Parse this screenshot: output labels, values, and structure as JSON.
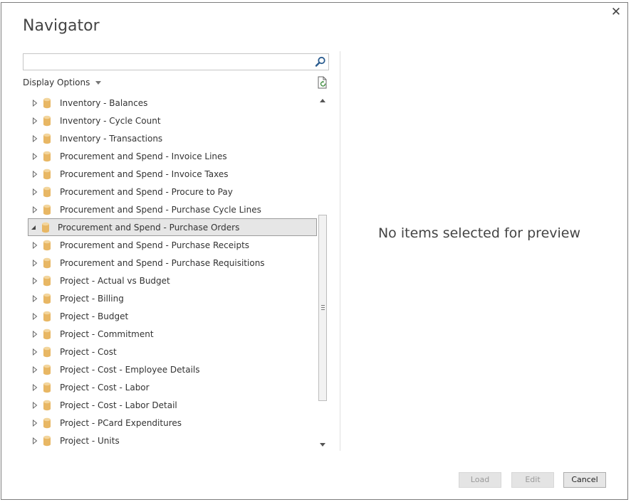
{
  "dialog": {
    "title": "Navigator",
    "close_icon": "close-icon"
  },
  "search": {
    "value": "",
    "placeholder": "",
    "icon": "search-icon"
  },
  "display_options": {
    "label": "Display Options",
    "icon": "chevron-down-icon"
  },
  "refresh": {
    "icon": "refresh-icon"
  },
  "tree": {
    "items": [
      {
        "label": "Inventory - Balances",
        "icon": "database-icon",
        "expanded": false,
        "selected": false
      },
      {
        "label": "Inventory - Cycle Count",
        "icon": "database-icon",
        "expanded": false,
        "selected": false
      },
      {
        "label": "Inventory - Transactions",
        "icon": "database-icon",
        "expanded": false,
        "selected": false
      },
      {
        "label": "Procurement and Spend - Invoice Lines",
        "icon": "database-icon",
        "expanded": false,
        "selected": false
      },
      {
        "label": "Procurement and Spend - Invoice Taxes",
        "icon": "database-icon",
        "expanded": false,
        "selected": false
      },
      {
        "label": "Procurement and Spend - Procure to Pay",
        "icon": "database-icon",
        "expanded": false,
        "selected": false
      },
      {
        "label": "Procurement and Spend - Purchase Cycle Lines",
        "icon": "database-icon",
        "expanded": false,
        "selected": false
      },
      {
        "label": "Procurement and Spend - Purchase Orders",
        "icon": "database-icon",
        "expanded": true,
        "selected": true
      },
      {
        "label": "Procurement and Spend - Purchase Receipts",
        "icon": "database-icon",
        "expanded": false,
        "selected": false
      },
      {
        "label": "Procurement and Spend - Purchase Requisitions",
        "icon": "database-icon",
        "expanded": false,
        "selected": false
      },
      {
        "label": "Project - Actual vs Budget",
        "icon": "database-icon",
        "expanded": false,
        "selected": false
      },
      {
        "label": "Project - Billing",
        "icon": "database-icon",
        "expanded": false,
        "selected": false
      },
      {
        "label": "Project - Budget",
        "icon": "database-icon",
        "expanded": false,
        "selected": false
      },
      {
        "label": "Project - Commitment",
        "icon": "database-icon",
        "expanded": false,
        "selected": false
      },
      {
        "label": "Project - Cost",
        "icon": "database-icon",
        "expanded": false,
        "selected": false
      },
      {
        "label": "Project - Cost - Employee Details",
        "icon": "database-icon",
        "expanded": false,
        "selected": false
      },
      {
        "label": "Project - Cost - Labor",
        "icon": "database-icon",
        "expanded": false,
        "selected": false
      },
      {
        "label": "Project - Cost - Labor Detail",
        "icon": "database-icon",
        "expanded": false,
        "selected": false
      },
      {
        "label": "Project - PCard Expenditures",
        "icon": "database-icon",
        "expanded": false,
        "selected": false
      },
      {
        "label": "Project - Units",
        "icon": "database-icon",
        "expanded": false,
        "selected": false
      }
    ]
  },
  "preview": {
    "empty_message": "No items selected for preview"
  },
  "footer": {
    "load_label": "Load",
    "edit_label": "Edit",
    "cancel_label": "Cancel"
  },
  "colors": {
    "db_icon": "#e8b764",
    "selected_row": "#e6e6e6"
  }
}
